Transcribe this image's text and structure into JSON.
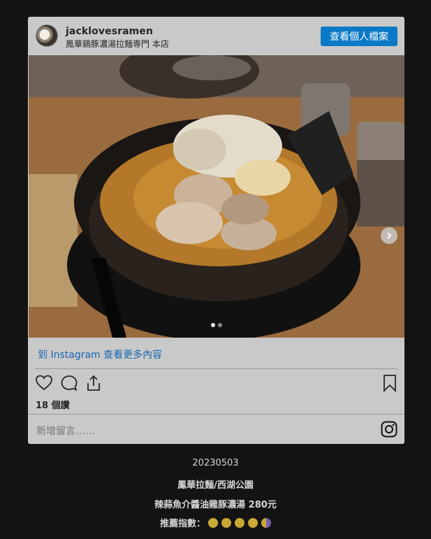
{
  "post": {
    "username": "jacklovesramen",
    "location": "鳳華鷄豚濃湯拉麵専門 本店",
    "view_profile_label": "查看個人檔案",
    "more_link": "到 Instagram 查看更多內容",
    "likes": "18 個讚",
    "comment_placeholder": "新增留言……",
    "carousel": {
      "total": 2,
      "current": 1
    }
  },
  "caption": {
    "date": "20230503",
    "place": "鳳華拉麵/西湖公園",
    "dish": "辣蒜魚介醬油雞豚濃湯 280元",
    "rating_label": "推薦指數：",
    "rating_value": 4.5,
    "rating_max": 5
  },
  "colors": {
    "background": "#131313",
    "card": "#c9c9c9",
    "button": "#0a7ac6",
    "link": "#1a66b3",
    "rating_coin": "#c9a836"
  },
  "icons": [
    "heart-icon",
    "comment-icon",
    "share-icon",
    "bookmark-icon",
    "instagram-icon",
    "chevron-right-icon"
  ]
}
